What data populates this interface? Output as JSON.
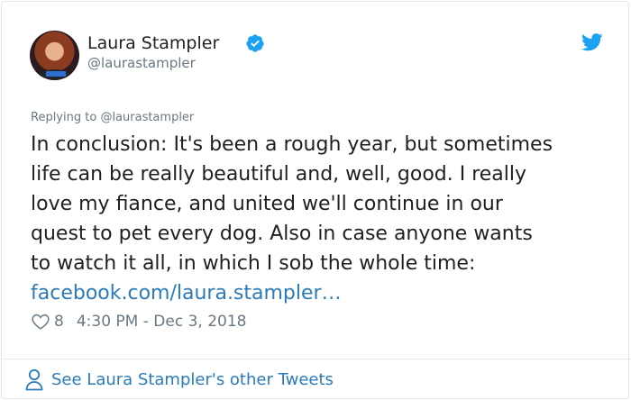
{
  "author": {
    "name": "Laura Stampler",
    "handle": "@laurastampler",
    "verified": true
  },
  "reply_context": {
    "prefix": "Replying to",
    "handle": "@laurastampler"
  },
  "tweet": {
    "text_lines": [
      "In conclusion: It's been a rough year, but sometimes",
      "life can be really beautiful and, well, good. I really",
      "love my fiance, and united we'll continue in our",
      "quest to pet every dog. Also in case anyone wants",
      "to watch it all, in which I sob the whole time:"
    ],
    "link_text": "facebook.com/laura.stampler…"
  },
  "meta": {
    "like_count": "8",
    "timestamp": "4:30 PM - Dec 3, 2018"
  },
  "footer": {
    "label": "See Laura Stampler's other Tweets"
  },
  "colors": {
    "link": "#2b7bb9",
    "secondary_text": "#697882",
    "primary_text": "#1c2022",
    "twitter_blue": "#1da1f2",
    "border": "#e1e8ed"
  },
  "icons": {
    "verified": "verified-badge-icon",
    "brand": "twitter-bird-icon",
    "like": "heart-icon",
    "profile": "person-icon"
  }
}
